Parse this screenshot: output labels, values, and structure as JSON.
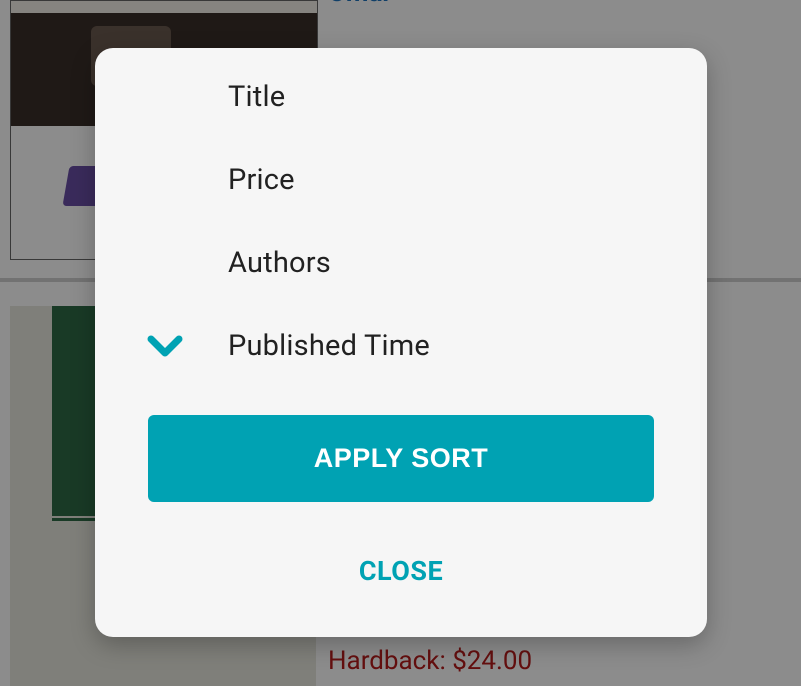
{
  "background": {
    "author_name": "Omar",
    "price_text": "Hardback: $24.00"
  },
  "sort_dialog": {
    "options": [
      {
        "label": "Title",
        "selected": false
      },
      {
        "label": "Price",
        "selected": false
      },
      {
        "label": "Authors",
        "selected": false
      },
      {
        "label": "Published Time",
        "selected": true
      }
    ],
    "selected_icon": "chevron-down-icon",
    "apply_label": "APPLY SORT",
    "close_label": "CLOSE"
  },
  "colors": {
    "accent": "#00a2b3",
    "price": "#b71c1c",
    "author_link": "#1e73be"
  }
}
